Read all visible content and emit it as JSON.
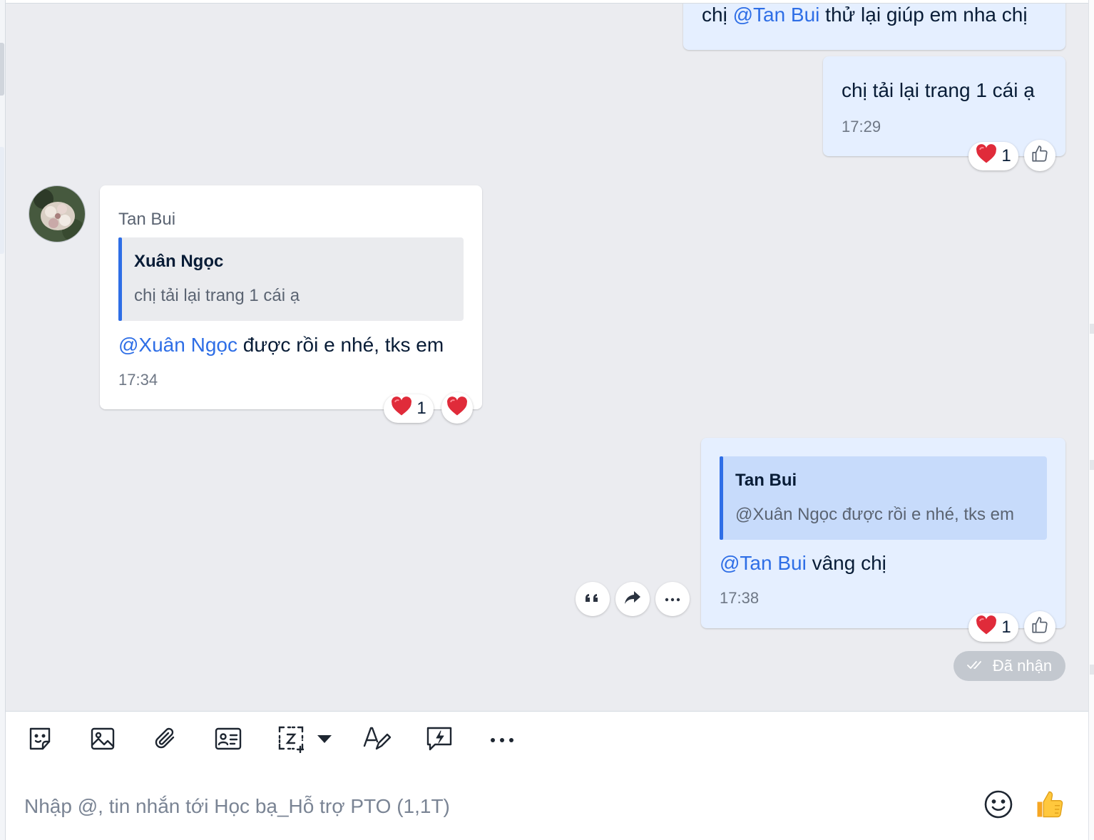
{
  "conversation_name": "Học bạ_Hỗ trợ PTO (1,1T)",
  "messages": [
    {
      "id": "m1",
      "direction": "outgoing",
      "text_prefix": "chị ",
      "mention": "@Tan Bui",
      "text_suffix": " thử lại giúp em nha chị"
    },
    {
      "id": "m2",
      "direction": "outgoing",
      "text": "chị tải lại trang 1 cái ạ",
      "time": "17:29",
      "reaction": {
        "emoji": "❤️",
        "count": "1"
      }
    },
    {
      "id": "m3",
      "direction": "incoming",
      "sender": "Tan Bui",
      "quote": {
        "name": "Xuân Ngọc",
        "text": "chị tải lại trang 1 cái ạ"
      },
      "mention": "@Xuân Ngọc",
      "text_suffix": " được rồi e nhé, tks em",
      "time": "17:34",
      "reaction": {
        "emoji": "❤️",
        "count": "1"
      }
    },
    {
      "id": "m4",
      "direction": "outgoing",
      "quote": {
        "name": "Tan Bui",
        "text": "@Xuân Ngọc được rồi e nhé, tks em"
      },
      "mention": "@Tan Bui",
      "text_suffix": " vâng chị",
      "time": "17:38",
      "reaction": {
        "emoji": "❤️",
        "count": "1"
      },
      "status": "Đã nhận"
    }
  ],
  "message_actions": [
    "quote-icon",
    "forward-icon",
    "more-icon"
  ],
  "toolbar": {
    "items": [
      "sticker-icon",
      "image-icon",
      "attachment-icon",
      "contact-card-icon",
      "screenshot-icon",
      "format-text-icon",
      "quick-message-icon",
      "more-icon"
    ]
  },
  "composer": {
    "placeholder": "Nhập @, tin nhắn tới Học bạ_Hỗ trợ PTO (1,1T)",
    "emoji_icon": "emoji-icon",
    "send_icon": "thumbs-up-icon"
  },
  "colors": {
    "accent": "#2e6ee6",
    "outgoing_bubble": "#e5efff",
    "incoming_bubble": "#ffffff",
    "chat_background": "#ebecf0",
    "quote_incoming_bg": "#eaebee",
    "quote_outgoing_bg": "#c7dbfb",
    "heart": "#e02b3a"
  }
}
